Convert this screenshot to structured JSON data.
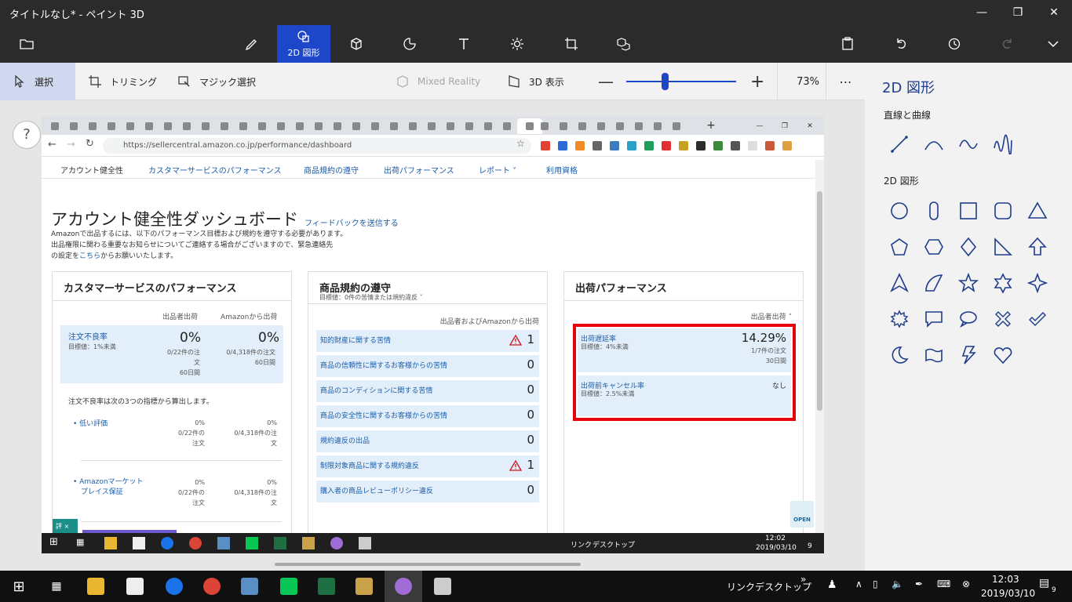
{
  "window": {
    "title": "タイトルなし* - ペイント 3D"
  },
  "toolbar": {
    "shapes2d_label": "2D 図形"
  },
  "subbar": {
    "select": "選択",
    "trim": "トリミング",
    "magic": "マジック選択",
    "mixed_reality": "Mixed Reality",
    "view3d": "3D 表示",
    "zoom_level": "73%"
  },
  "sidepanel": {
    "title": "2D 図形",
    "lines_section": "直線と曲線",
    "shapes_section": "2D 図形"
  },
  "help": "?",
  "browser": {
    "url": "https://sellercentral.amazon.co.jp/performance/dashboard",
    "new_tab": "+"
  },
  "seller": {
    "nav": [
      "アカウント健全性",
      "カスタマーサービスのパフォーマンス",
      "商品規約の遵守",
      "出荷パフォーマンス",
      "レポート ˅",
      "利用資格"
    ],
    "page_title": "アカウント健全性ダッシュボード",
    "feedback_link": "フィードバックを送信する",
    "intro1": "Amazonで出品するには、以下のパフォーマンス目標および規約を遵守する必要があります。",
    "intro2": "出品権限に関わる重要なお知らせについてご連絡する場合がございますので、緊急連絡先",
    "intro3a": "の設定を",
    "intro3_link": "こちら",
    "intro3b": "からお願いいたします。",
    "cs": {
      "title": "カスタマーサービスのパフォーマンス",
      "col1": "出品者出荷",
      "col2": "Amazonから出荷",
      "odr_label": "注文不良率",
      "odr_target": "目標値：1%未満",
      "odr_v1": "0%",
      "odr_v2": "0%",
      "odr_d1a": "0/22件の注",
      "odr_d1b": "文",
      "odr_d1c": "60日間",
      "odr_d2a": "0/4,318件の注文",
      "odr_d2b": "60日間",
      "odr_note": "注文不良率は次の3つの指標から算出します。",
      "sub1_label": "低い評価",
      "sub1_v1": "0%",
      "sub1_v2": "0%",
      "sub1_d1a": "0/22件の",
      "sub1_d1b": "注文",
      "sub1_d2a": "0/4,318件の注",
      "sub1_d2b": "文",
      "sub2_label_a": "Amazonマーケット",
      "sub2_label_b": "プレイス保証",
      "sub2_v1": "0%",
      "sub2_v2": "0%",
      "sub2_d1a": "0/22件の",
      "sub2_d1b": "注文",
      "sub2_d2a": "0/4,318件の注",
      "sub2_d2b": "文"
    },
    "policy": {
      "title": "商品規約の遵守",
      "subtitle": "目標値：0件の苦情または規約違反 ˅",
      "col": "出品者およびAmazonから出荷",
      "rows": [
        {
          "label": "知的財産に関する苦情",
          "value": "1"
        },
        {
          "label": "商品の信頼性に関するお客様からの苦情",
          "value": "0"
        },
        {
          "label": "商品のコンディションに関する苦情",
          "value": "0"
        },
        {
          "label": "商品の安全性に関するお客様からの苦情",
          "value": "0"
        },
        {
          "label": "規約違反の出品",
          "value": "0"
        },
        {
          "label": "制限対象商品に関する規約違反",
          "value": "1"
        },
        {
          "label": "購入者の商品レビューポリシー違反",
          "value": "0"
        }
      ]
    },
    "shipping": {
      "title": "出荷パフォーマンス",
      "col": "出品者出荷 ˅",
      "late_label": "出荷遅延率",
      "late_target": "目標値：4%未満",
      "late_value": "14.29%",
      "late_detail1": "1/7件の注文",
      "late_detail2": "30日間",
      "cancel_label": "出荷前キャンセル率",
      "cancel_target": "目標値：2.5%未満",
      "cancel_value": "なし",
      "open_badge": "OPEN"
    }
  },
  "inner_taskbar": {
    "link": "リンク",
    "desktop": "デスクトップ",
    "time": "12:02",
    "date": "2019/03/10",
    "notif": "9",
    "eval_label": "評"
  },
  "taskbar": {
    "link": "リンク",
    "desktop": "デスクトップ",
    "time": "12:03",
    "date": "2019/03/10",
    "notif": "9"
  }
}
